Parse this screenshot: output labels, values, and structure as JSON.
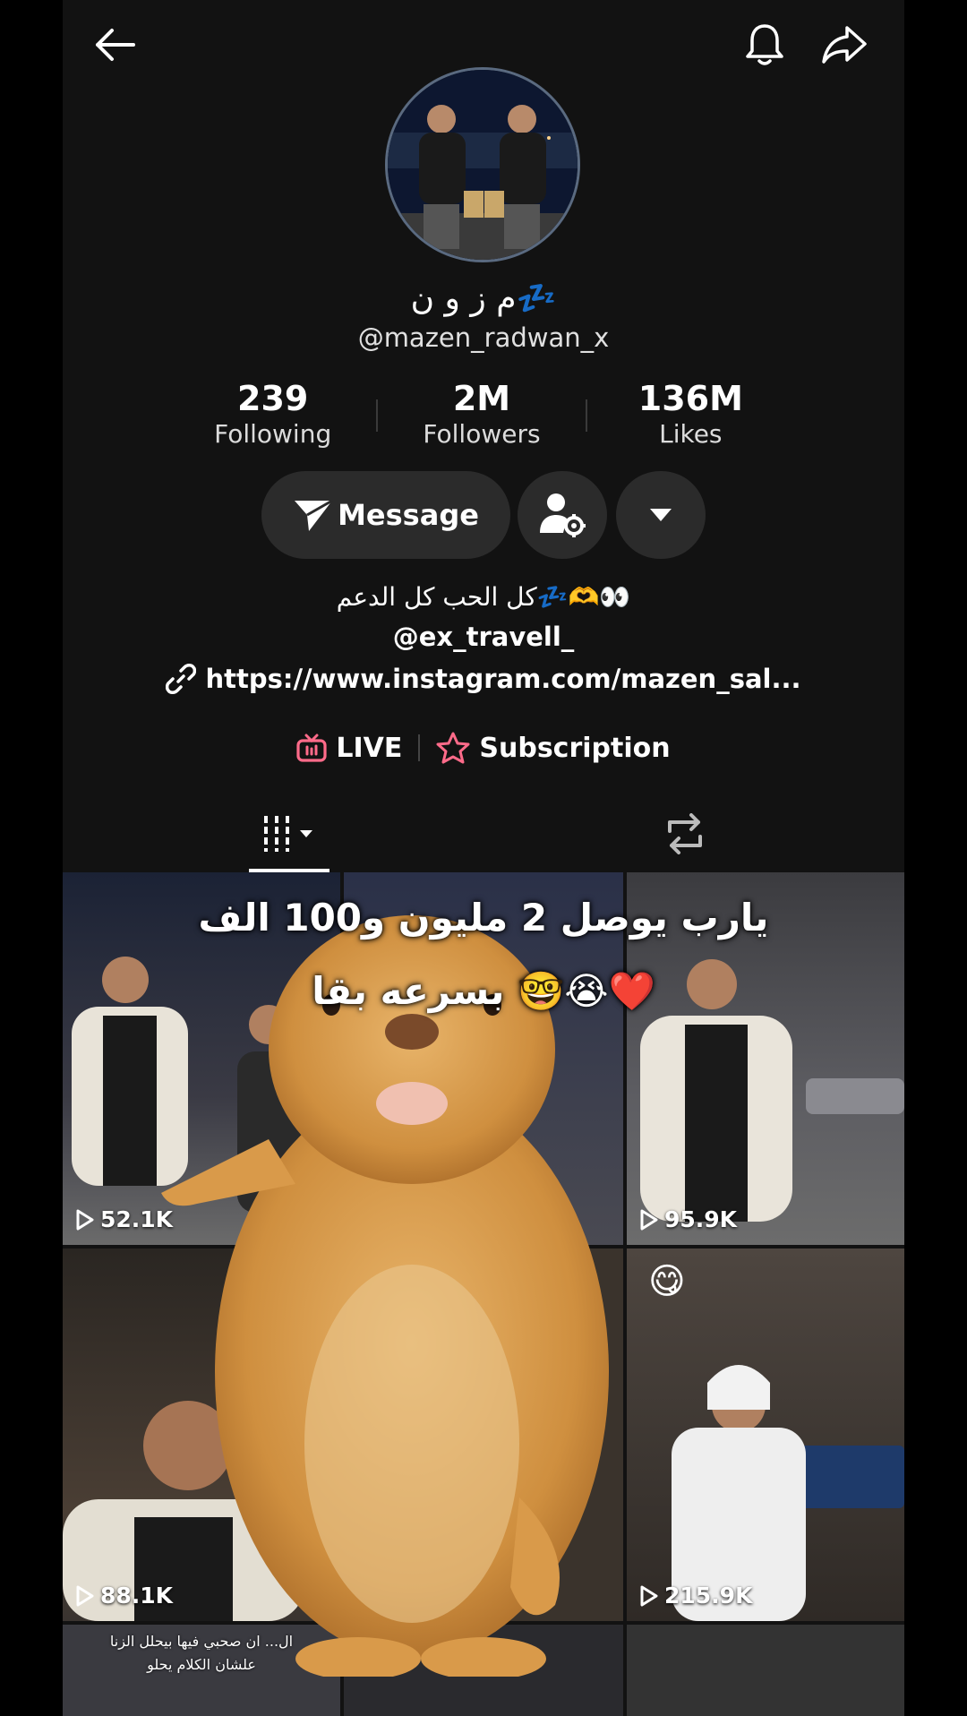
{
  "profile": {
    "display_name": "م ز و ن💤",
    "handle": "@mazen_radwan_x",
    "stats": [
      {
        "value": "239",
        "label": "Following"
      },
      {
        "value": "2M",
        "label": "Followers"
      },
      {
        "value": "136M",
        "label": "Likes"
      }
    ],
    "message_label": "Message",
    "bio_line": "كل الحب كل الدعم💤🫶👀",
    "bio_mention": "@ex_travell_",
    "link": "https://www.instagram.com/mazen_sal...",
    "live_label": "LIVE",
    "subscription_label": "Subscription"
  },
  "icons": {
    "back": "arrow-left-icon",
    "bell": "bell-icon",
    "share": "share-icon",
    "send": "send-icon",
    "user_settings": "user-gear-icon",
    "dropdown": "caret-down-icon",
    "link": "link-icon",
    "live": "tv-icon",
    "subscription": "star-icon",
    "grid_tab": "grid-icon",
    "repost_tab": "repost-icon",
    "play": "play-icon"
  },
  "colors": {
    "background": "#121212",
    "pill": "#2b2b2b",
    "accent_pink": "#fe2c55",
    "live_pink": "#ff6b8a"
  },
  "videos": [
    {
      "views": "52.1K"
    },
    {
      "views": "95.9K"
    },
    {
      "views": "88.1K"
    },
    {
      "views": "215.9K"
    }
  ],
  "tile_caption": {
    "line1": "ال... ان صحبي فيها بيحلل الزنا",
    "line2": "علشان الكلام يحلو"
  },
  "overlay": {
    "line1": "يارب يوصل 2 مليون و100 الف",
    "line2": "بسرعه بقا 🤓😭❤️"
  }
}
